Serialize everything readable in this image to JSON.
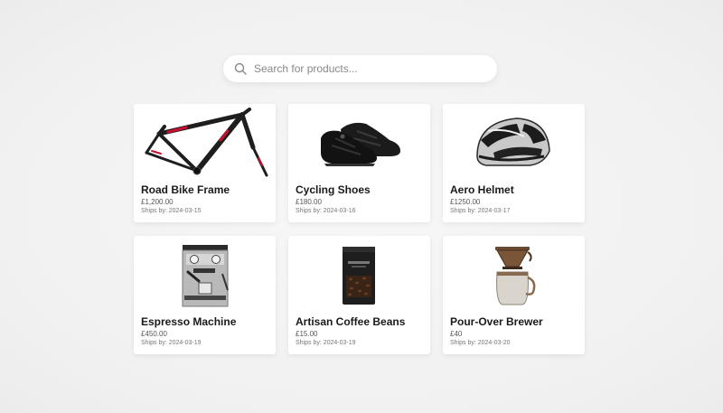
{
  "search": {
    "placeholder": "Search for products..."
  },
  "products": [
    {
      "name": "Road Bike Frame",
      "price": "£1,200.00",
      "ships": "Ships by: 2024-03-15",
      "icon": "bike-frame-icon"
    },
    {
      "name": "Cycling Shoes",
      "price": "£180.00",
      "ships": "Ships by: 2024-03-16",
      "icon": "cycling-shoes-icon"
    },
    {
      "name": "Aero Helmet",
      "price": "£1250.00",
      "ships": "Ships by: 2024-03-17",
      "icon": "helmet-icon"
    },
    {
      "name": "Espresso Machine",
      "price": "£450.00",
      "ships": "Ships by: 2024-03-19",
      "icon": "espresso-machine-icon"
    },
    {
      "name": "Artisan Coffee Beans",
      "price": "£15.00",
      "ships": "Ships by: 2024-03-19",
      "icon": "coffee-bag-icon"
    },
    {
      "name": "Pour-Over Brewer",
      "price": "£40",
      "ships": "Ships by: 2024-03-20",
      "icon": "pour-over-icon"
    }
  ],
  "colors": {
    "background": "#f2f2f2",
    "card": "#ffffff",
    "accent_red": "#c8102e"
  }
}
